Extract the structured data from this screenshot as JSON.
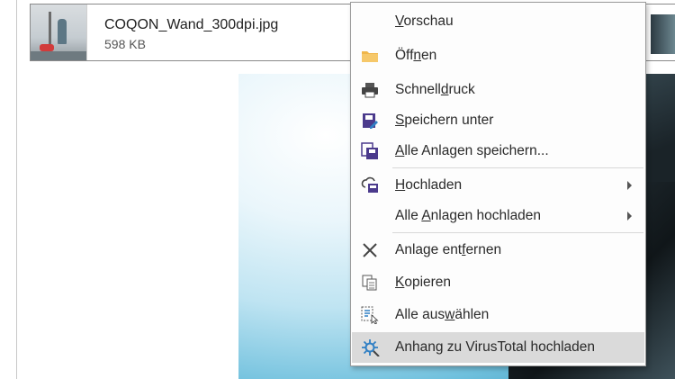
{
  "attachment": {
    "file_name": "COQON_Wand_300dpi.jpg",
    "file_size": "598 KB"
  },
  "context_menu": {
    "items": [
      {
        "pre": "",
        "u": "V",
        "post": "orschau",
        "icon": "none"
      },
      {
        "pre": "Öff",
        "u": "n",
        "post": "en",
        "icon": "folder-icon"
      },
      {
        "pre": "Schnell",
        "u": "d",
        "post": "ruck",
        "icon": "printer-icon"
      },
      {
        "pre": "",
        "u": "S",
        "post": "peichern unter",
        "icon": "save-as-icon"
      },
      {
        "pre": "",
        "u": "A",
        "post": "lle Anlagen speichern...",
        "icon": "save-all-icon"
      },
      {
        "pre": "",
        "u": "H",
        "post": "ochladen",
        "icon": "cloud-upload-icon",
        "submenu": true
      },
      {
        "pre": "Alle ",
        "u": "A",
        "post": "nlagen hochladen",
        "icon": "none",
        "submenu": true
      },
      {
        "pre": "Anlage ent",
        "u": "f",
        "post": "ernen",
        "icon": "remove-icon"
      },
      {
        "pre": "",
        "u": "K",
        "post": "opieren",
        "icon": "copy-icon"
      },
      {
        "pre": "Alle aus",
        "u": "w",
        "post": "ählen",
        "icon": "select-all-icon"
      },
      {
        "pre": "Anhang zu VirusTotal hochladen",
        "u": "",
        "post": "",
        "icon": "virustotal-icon",
        "highlighted": true
      }
    ]
  },
  "colors": {
    "menu_background": "#fdfdfd",
    "highlight": "#dadada",
    "folder": "#f0b64a",
    "save_icons": "#4b3a8c",
    "virustotal": "#2f7fc4"
  }
}
